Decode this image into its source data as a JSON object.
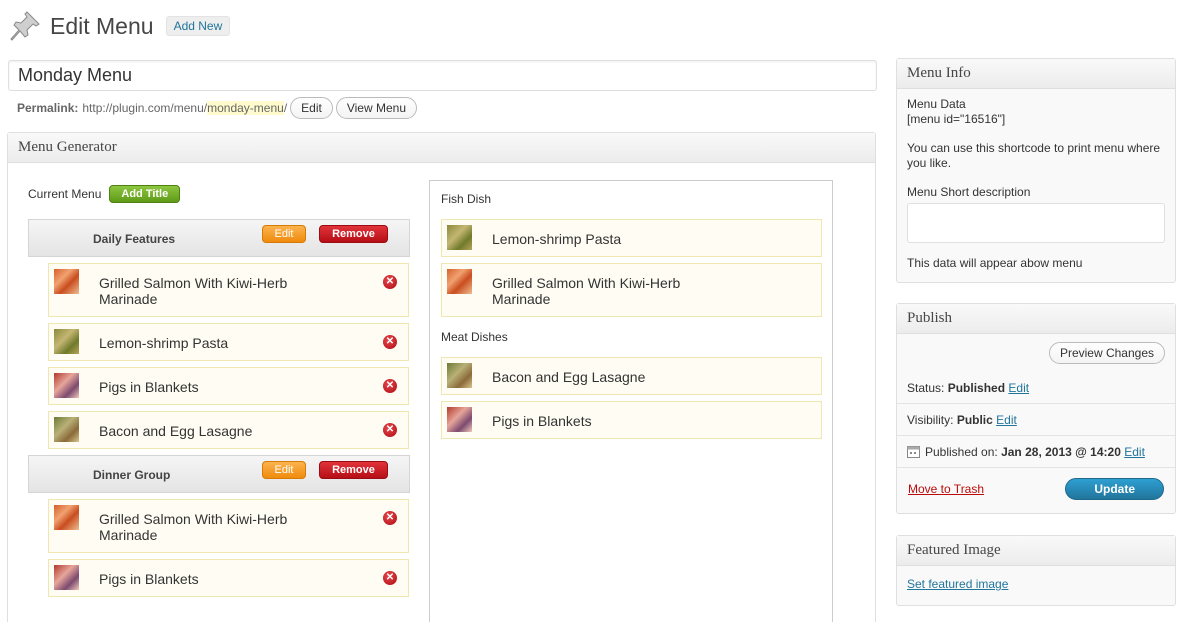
{
  "header": {
    "title": "Edit Menu",
    "add_new": "Add New"
  },
  "title_input": {
    "value": "Monday Menu"
  },
  "permalink": {
    "label": "Permalink:",
    "base": "http://plugin.com/menu/",
    "slug": "monday-menu",
    "suffix": "/",
    "edit_label": "Edit",
    "view_label": "View Menu"
  },
  "menu_generator": {
    "title": "Menu Generator",
    "current_menu_label": "Current Menu",
    "add_title_label": "Add Title",
    "groups": [
      {
        "title": "Daily Features",
        "edit_label": "Edit",
        "remove_label": "Remove",
        "items": [
          {
            "name": "Grilled Salmon With Kiwi-Herb Marinade",
            "thumb": "salmon"
          },
          {
            "name": "Lemon-shrimp Pasta",
            "thumb": "pasta"
          },
          {
            "name": "Pigs in Blankets",
            "thumb": "pigs"
          },
          {
            "name": "Bacon and Egg Lasagne",
            "thumb": "lasagne"
          }
        ]
      },
      {
        "title": "Dinner Group",
        "edit_label": "Edit",
        "remove_label": "Remove",
        "items": [
          {
            "name": "Grilled Salmon With Kiwi-Herb Marinade",
            "thumb": "salmon"
          },
          {
            "name": "Pigs in Blankets",
            "thumb": "pigs"
          }
        ]
      }
    ],
    "categories": [
      {
        "name": "Fish Dish",
        "items": [
          {
            "name": "Lemon-shrimp Pasta",
            "thumb": "pasta"
          },
          {
            "name": "Grilled Salmon With Kiwi-Herb Marinade",
            "thumb": "salmon"
          }
        ]
      },
      {
        "name": "Meat Dishes",
        "items": [
          {
            "name": "Bacon and Egg Lasagne",
            "thumb": "lasagne"
          },
          {
            "name": "Pigs in Blankets",
            "thumb": "pigs"
          }
        ]
      }
    ]
  },
  "menu_info": {
    "title": "Menu Info",
    "data_label": "Menu Data",
    "shortcode": "[menu id=\"16516\"]",
    "shortcode_help": "You can use this shortcode to print menu where you like.",
    "short_desc_label": "Menu Short description",
    "short_desc_value": "",
    "short_desc_help": "This data will appear abow menu"
  },
  "publish": {
    "title": "Publish",
    "preview_label": "Preview Changes",
    "status_label": "Status:",
    "status_value": "Published",
    "visibility_label": "Visibility:",
    "visibility_value": "Public",
    "published_on_label": "Published on:",
    "published_on_value": "Jan 28, 2013 @ 14:20",
    "edit_label": "Edit",
    "trash_label": "Move to Trash",
    "update_label": "Update"
  },
  "featured_image": {
    "title": "Featured Image",
    "link": "Set featured image"
  }
}
